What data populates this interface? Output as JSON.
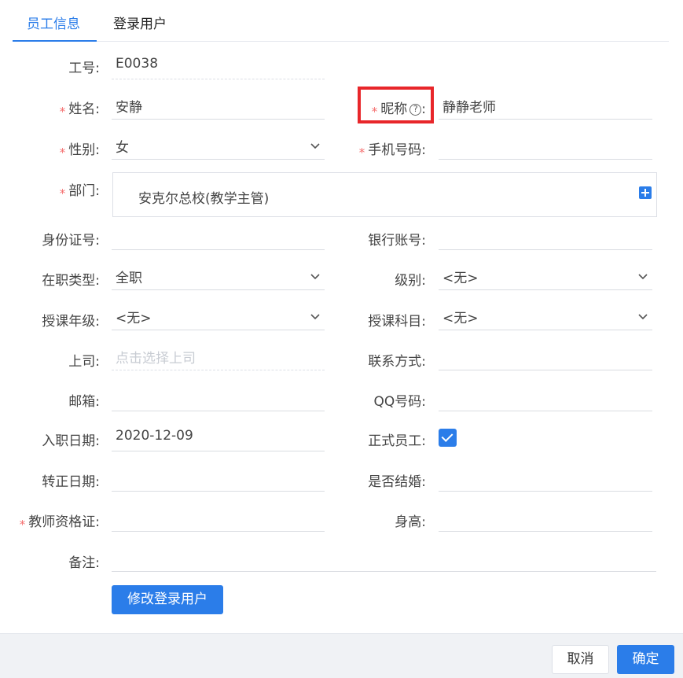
{
  "tabs": [
    {
      "label": "员工信息",
      "active": true
    },
    {
      "label": "登录用户",
      "active": false
    }
  ],
  "form": {
    "emp_no": {
      "label": "工号:",
      "value": "E0038"
    },
    "name": {
      "label": "姓名:",
      "value": "安静"
    },
    "nickname": {
      "label": "昵称",
      "colon": ":",
      "value": "静静老师"
    },
    "gender": {
      "label": "性别:",
      "value": "女"
    },
    "phone": {
      "label": "手机号码:",
      "value": ""
    },
    "dept": {
      "label": "部门:",
      "value": "安克尔总校(教学主管)"
    },
    "id_card": {
      "label": "身份证号:",
      "value": ""
    },
    "bank": {
      "label": "银行账号:",
      "value": ""
    },
    "job_type": {
      "label": "在职类型:",
      "value": "全职"
    },
    "level": {
      "label": "级别:",
      "value": "<无>"
    },
    "grade": {
      "label": "授课年级:",
      "value": "<无>"
    },
    "subject": {
      "label": "授课科目:",
      "value": "<无>"
    },
    "boss": {
      "label": "上司:",
      "placeholder": "点击选择上司"
    },
    "contact": {
      "label": "联系方式:",
      "value": ""
    },
    "email": {
      "label": "邮箱:",
      "value": ""
    },
    "qq": {
      "label": "QQ号码:",
      "value": ""
    },
    "entry_date": {
      "label": "入职日期:",
      "value": "2020-12-09"
    },
    "formal": {
      "label": "正式员工:",
      "checked": true
    },
    "regular_date": {
      "label": "转正日期:",
      "value": ""
    },
    "married": {
      "label": "是否结婚:",
      "value": ""
    },
    "cert": {
      "label": "教师资格证:",
      "value": ""
    },
    "height": {
      "label": "身高:",
      "value": ""
    },
    "remark": {
      "label": "备注:",
      "value": ""
    }
  },
  "required_mark": "*",
  "help_glyph": "?",
  "buttons": {
    "modify_login": "修改登录用户",
    "cancel": "取消",
    "ok": "确定"
  },
  "colors": {
    "accent": "#2b7de9",
    "required": "#f56c6c",
    "highlight": "#e8262a"
  }
}
